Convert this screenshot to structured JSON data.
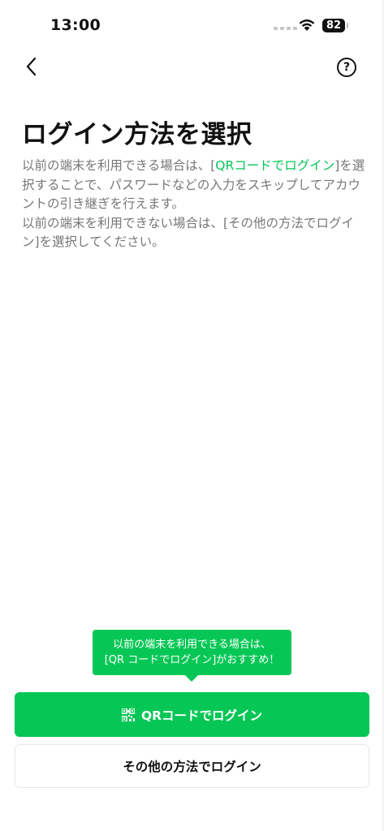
{
  "status_bar": {
    "time": "13:00",
    "battery": "82",
    "icons": [
      "signal-icon",
      "wifi-icon",
      "battery-icon"
    ]
  },
  "header": {
    "back_icon": "chevron-left-icon",
    "help_label": "?"
  },
  "title": "ログイン方法を選択",
  "description": {
    "p1_before": "以前の端末を利用できる場合は、[",
    "p1_link": "QRコードでログイン",
    "p1_after": "]を選択することで、パスワードなどの入力をスキップしてアカウントの引き継ぎを行えます。",
    "p2": "以前の端末を利用できない場合は、[その他の方法でログイン]を選択してください。"
  },
  "tooltip": {
    "line1": "以前の端末を利用できる場合は、",
    "line2": "[QR コードでログイン]がおすすめ！"
  },
  "buttons": {
    "qr_label": "QRコードでログイン",
    "qr_icon": "qr-code-icon",
    "other_label": "その他の方法でログイン"
  },
  "colors": {
    "accent": "#06c755",
    "text": "#111111",
    "muted": "#777777",
    "background": "#ffffff"
  }
}
